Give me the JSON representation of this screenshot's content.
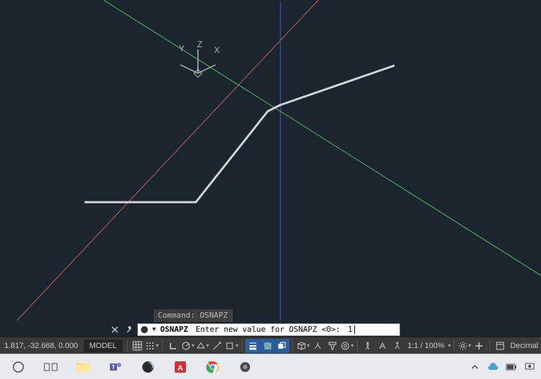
{
  "ucs": {
    "y": "Y",
    "z": "Z",
    "x": "X"
  },
  "history": {
    "line": "Command: OSNAPZ"
  },
  "command": {
    "name": "OSNAPZ",
    "prompt": "Enter new value for OSNAPZ <0>:",
    "value": "1"
  },
  "status": {
    "coords": "1.817, -32.668, 0.000",
    "model": "MODEL",
    "scale": "1:1 / 100%",
    "units": "Decimal"
  },
  "colors": {
    "axisRed": "#d05b5b",
    "axisGreen": "#4fbf4f",
    "axisBlue": "#3a4fd8",
    "polyline": "#d4d4d4",
    "canvas": "#1b2530"
  }
}
